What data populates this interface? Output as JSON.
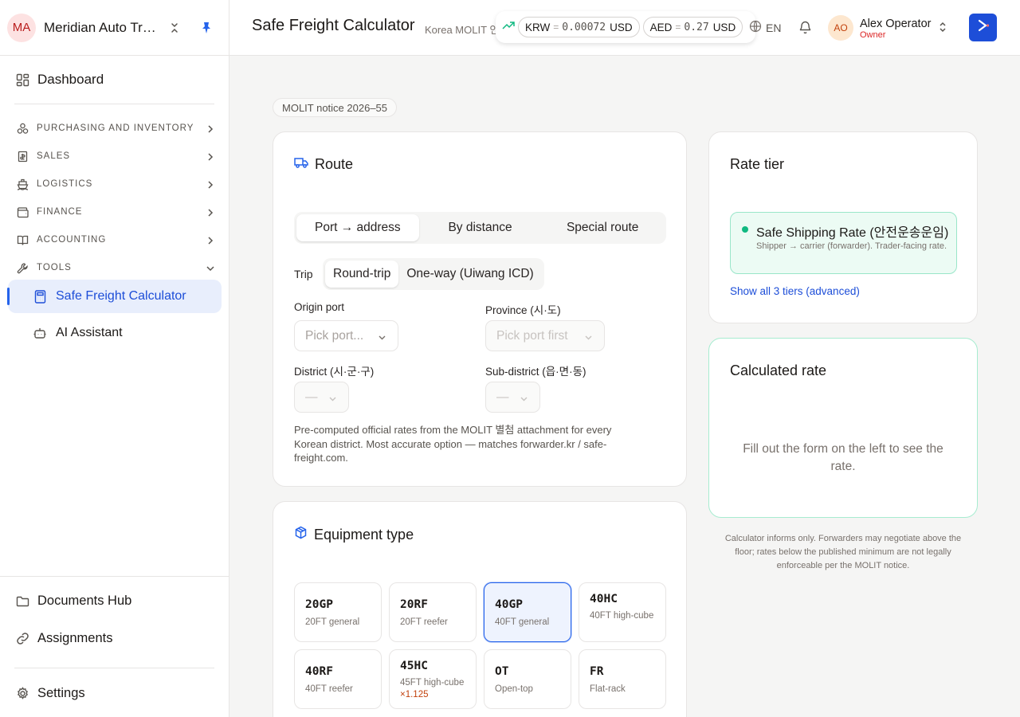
{
  "org": {
    "initials": "MA",
    "name": "Meridian Auto Trading"
  },
  "sidebar": {
    "dashboard": "Dashboard",
    "groups": [
      "PURCHASING AND INVENTORY",
      "SALES",
      "LOGISTICS",
      "FINANCE",
      "ACCOUNTING",
      "TOOLS"
    ],
    "tools_items": [
      "Safe Freight Calculator",
      "AI Assistant"
    ],
    "bottom": [
      "Documents Hub",
      "Assignments"
    ],
    "settings": "Settings"
  },
  "header": {
    "title": "Safe Freight Calculator",
    "subtitle": "Korea MOLIT 인",
    "fx": [
      {
        "code": "KRW",
        "eq": "=",
        "rate": "0.00072",
        "cur": "USD"
      },
      {
        "code": "AED",
        "eq": "=",
        "rate": "0.27",
        "cur": "USD"
      }
    ],
    "lang": "EN",
    "user": {
      "initials": "AO",
      "name": "Alex Operator",
      "role": "Owner"
    }
  },
  "notice": "MOLIT notice 2026–55",
  "route": {
    "title": "Route",
    "modes": [
      "Port → address",
      "By distance",
      "Special route"
    ],
    "trip_label": "Trip",
    "trips": [
      "Round-trip",
      "One-way (Uiwang ICD)"
    ],
    "origin_label": "Origin port",
    "origin_placeholder": "Pick port...",
    "province_label": "Province (시·도)",
    "province_placeholder": "Pick port first",
    "district_label": "District (시·군·구)",
    "district_placeholder": "—",
    "subdistrict_label": "Sub-district (읍·면·동)",
    "subdistrict_placeholder": "—",
    "help": "Pre-computed official rates from the MOLIT 별첨 attachment for every Korean district. Most accurate option — matches forwarder.kr / safe-freight.com."
  },
  "equipment": {
    "title": "Equipment type",
    "items": [
      {
        "code": "20GP",
        "desc": "20FT general"
      },
      {
        "code": "20RF",
        "desc": "20FT reefer"
      },
      {
        "code": "40GP",
        "desc": "40FT general"
      },
      {
        "code": "40HC",
        "desc": "40FT high-cube"
      },
      {
        "code": "40RF",
        "desc": "40FT reefer"
      },
      {
        "code": "45HC",
        "desc": "45FT high-cube",
        "mult": "×1.125"
      },
      {
        "code": "OT",
        "desc": "Open-top"
      },
      {
        "code": "FR",
        "desc": "Flat-rack"
      }
    ]
  },
  "rate_tier": {
    "title": "Rate tier",
    "name": "Safe Shipping Rate (안전운송운임)",
    "desc": "Shipper → carrier (forwarder). Trader-facing rate.",
    "link": "Show all 3 tiers (advanced)"
  },
  "calculated": {
    "title": "Calculated rate",
    "empty": "Fill out the form on the left to see the rate."
  },
  "disclaimer": "Calculator informs only. Forwarders may negotiate above the floor; rates below the published minimum are not legally enforceable per the MOLIT notice."
}
